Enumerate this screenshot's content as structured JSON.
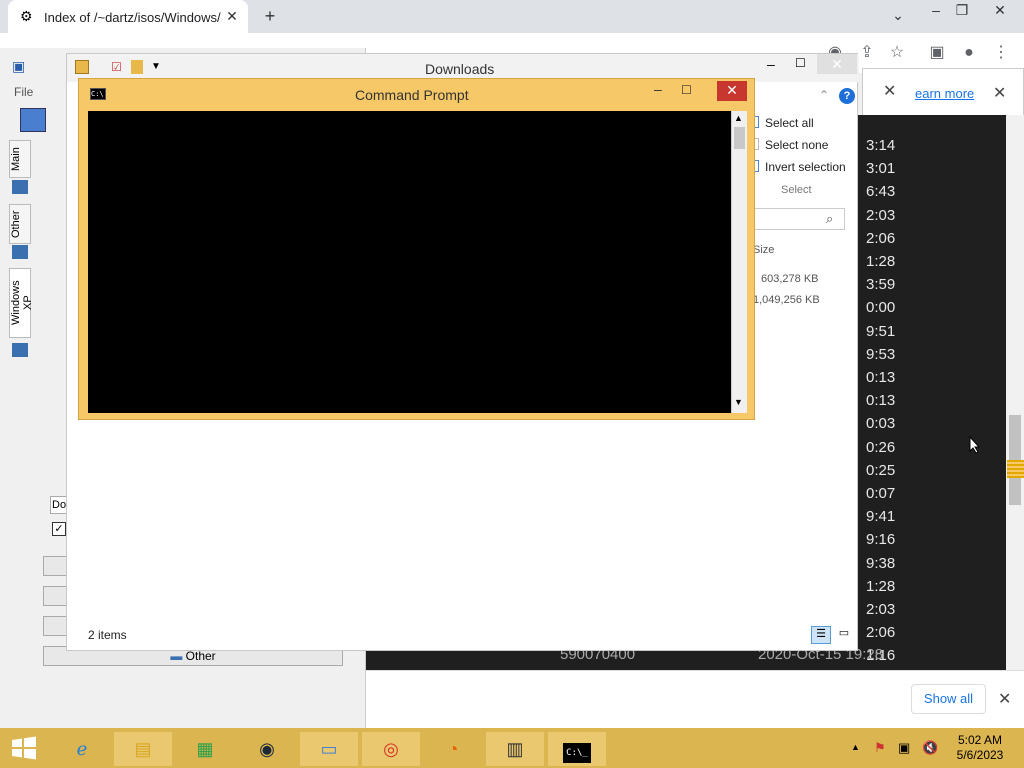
{
  "browser": {
    "tab_title": "Index of /~dartz/isos/Windows/",
    "new_tab_icon": "plus-icon",
    "learn_more": "earn more",
    "show_all": "Show all"
  },
  "listing": {
    "timestamps": [
      "3:14",
      "3:01",
      "6:43",
      "2:03",
      "2:06",
      "1:28",
      "3:59",
      "0:00",
      "9:51",
      "9:53",
      "0:13",
      "0:13",
      "0:03",
      "0:26",
      "0:25",
      "0:07",
      "9:41",
      "9:16",
      "9:38",
      "1:28",
      "2:03",
      "2:06",
      "1:16"
    ],
    "partial_row": {
      "size": "590070400",
      "date": "2020-Oct-15 19:28"
    }
  },
  "left_app": {
    "menu_file": "File",
    "vtabs": [
      "Main",
      "Other",
      "Windows XP"
    ],
    "down_label": "Dov",
    "other_button": "Other"
  },
  "explorer": {
    "title": "Downloads",
    "select_all": "Select all",
    "select_none": "Select none",
    "invert_selection": "Invert selection",
    "select_group": "Select",
    "size_header": "Size",
    "sizes": [
      "603,278 KB",
      "1,049,256 KB"
    ],
    "status": "2 items"
  },
  "cmd": {
    "title": "Command Prompt"
  },
  "taskbar": {
    "time": "5:02 AM",
    "date": "5/6/2023"
  },
  "colors": {
    "taskbar": "#dbb54f",
    "cmd_frame": "#f6c868",
    "close_red": "#c7372f",
    "link_blue": "#1a73e8"
  }
}
